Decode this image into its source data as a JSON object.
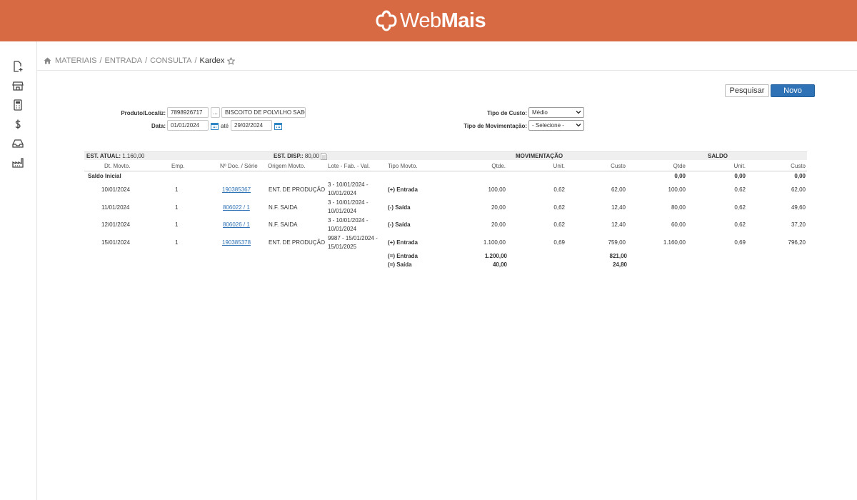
{
  "brand": {
    "name_light": "Web",
    "name_bold": "Mais",
    "color": "#d86a43"
  },
  "breadcrumb": {
    "items": [
      "MATERIAIS",
      "ENTRADA",
      "CONSULTA"
    ],
    "current": "Kardex"
  },
  "sidebar": {
    "icons": [
      "new-document-icon",
      "store-icon",
      "calculator-icon",
      "dollar-icon",
      "inbox-icon",
      "factory-icon"
    ]
  },
  "actions": {
    "search_label": "Pesquisar",
    "new_label": "Novo"
  },
  "filters": {
    "produto_label": "Produto/Localiz:",
    "produto_code": "7898926717",
    "produto_browse": "...",
    "produto_name": "BISCOITO DE POLVILHO SABOR",
    "data_label": "Data:",
    "date_from": "01/01/2024",
    "ate_label": "até",
    "date_to": "29/02/2024",
    "tipo_custo_label": "Tipo de Custo:",
    "tipo_custo_value": "Médio",
    "tipo_mov_label": "Tipo de Movimentação:",
    "tipo_mov_value": "- Selecione -"
  },
  "summary": {
    "est_atual_label": "EST. ATUAL:",
    "est_atual_value": "1.160,00",
    "est_disp_label": "EST. DISP.:",
    "est_disp_value": "80,00",
    "movimentacao_label": "MOVIMENTAÇÃO",
    "saldo_label": "SALDO"
  },
  "columns": [
    "Dt. Movto.",
    "Emp.",
    "Nº Doc. / Série",
    "Origem Movto.",
    "Lote - Fab. - Val.",
    "Tipo Movto.",
    "Qtde.",
    "Unit.",
    "Custo",
    "Qtde",
    "Unit.",
    "Custo"
  ],
  "saldo_inicial": {
    "label": "Saldo Inicial",
    "qtde": "0,00",
    "unit": "0,00",
    "custo": "0,00"
  },
  "rows": [
    {
      "date": "10/01/2024",
      "emp": "1",
      "doc": "190385367",
      "origem": "ENT. DE PRODUÇÃO",
      "lote1": "3 - 10/01/2024 -",
      "lote2": "10/01/2024",
      "tipo": "(+) Entrada",
      "m_qtde": "100,00",
      "m_unit": "0,62",
      "m_custo": "62,00",
      "s_qtde": "100,00",
      "s_unit": "0,62",
      "s_custo": "62,00"
    },
    {
      "date": "11/01/2024",
      "emp": "1",
      "doc": "806022 / 1",
      "origem": "N.F. SAIDA",
      "lote1": "3 - 10/01/2024 -",
      "lote2": "10/01/2024",
      "tipo": "(-) Saída",
      "m_qtde": "20,00",
      "m_unit": "0,62",
      "m_custo": "12,40",
      "s_qtde": "80,00",
      "s_unit": "0,62",
      "s_custo": "49,60"
    },
    {
      "date": "12/01/2024",
      "emp": "1",
      "doc": "806026 / 1",
      "origem": "N.F. SAIDA",
      "lote1": "3 - 10/01/2024 -",
      "lote2": "10/01/2024",
      "tipo": "(-) Saída",
      "m_qtde": "20,00",
      "m_unit": "0,62",
      "m_custo": "12,40",
      "s_qtde": "60,00",
      "s_unit": "0,62",
      "s_custo": "37,20"
    },
    {
      "date": "15/01/2024",
      "emp": "1",
      "doc": "190385378",
      "origem": "ENT. DE PRODUÇÃO",
      "lote1": "9987 - 15/01/2024 -",
      "lote2": "15/01/2025",
      "tipo": "(+) Entrada",
      "m_qtde": "1.100,00",
      "m_unit": "0,69",
      "m_custo": "759,00",
      "s_qtde": "1.160,00",
      "s_unit": "0,69",
      "s_custo": "796,20"
    }
  ],
  "totals": [
    {
      "label": "(=) Entrada",
      "qtde": "1.200,00",
      "custo": "821,00"
    },
    {
      "label": "(=) Saída",
      "qtde": "40,00",
      "custo": "24,80"
    }
  ]
}
